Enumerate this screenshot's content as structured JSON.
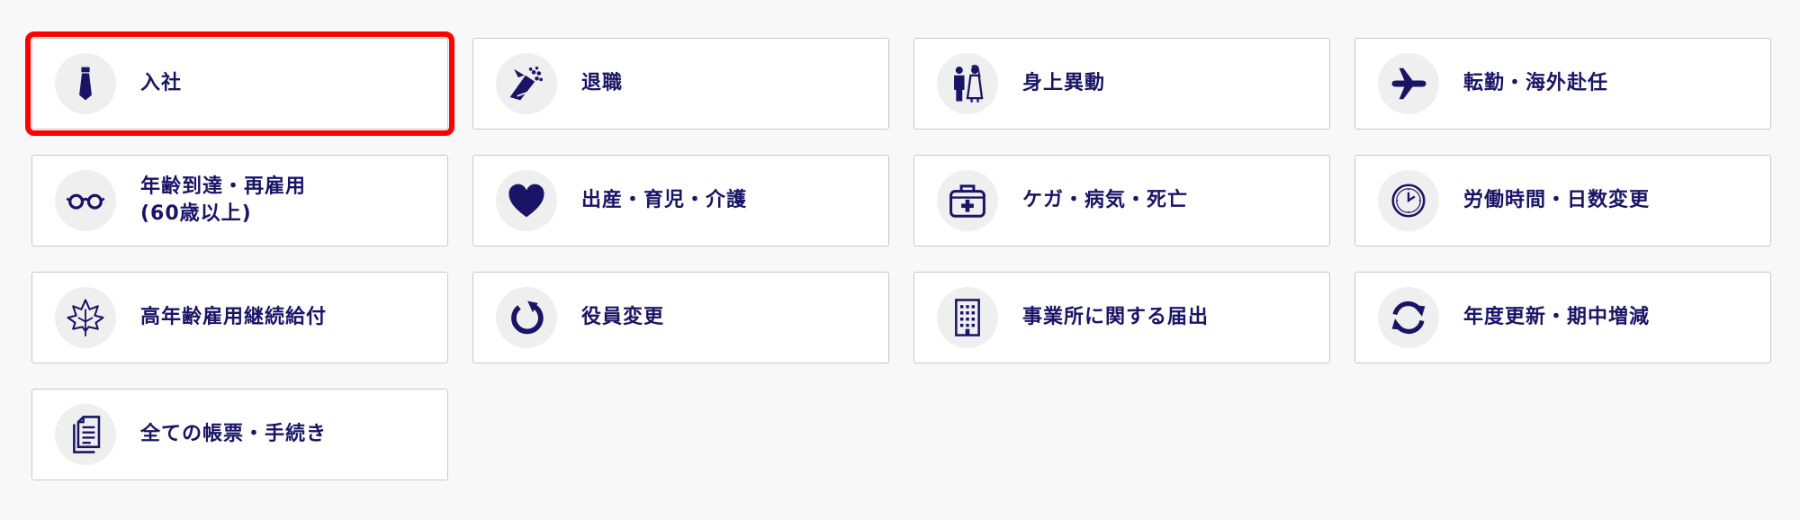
{
  "colors": {
    "icon": "#1a1466",
    "text": "#1a1466",
    "icon_bg": "#efefef",
    "selection": "#ff0000"
  },
  "procedures": [
    {
      "label": "入社",
      "icon": "necktie-icon",
      "selected": true
    },
    {
      "label": "退職",
      "icon": "bouquet-icon"
    },
    {
      "label": "身上異動",
      "icon": "wedding-couple-icon"
    },
    {
      "label": "転勤・海外赴任",
      "icon": "airplane-icon"
    },
    {
      "label": "年齢到達・再雇用",
      "label_line2": "(60歳以上)",
      "icon": "glasses-icon"
    },
    {
      "label": "出産・育児・介護",
      "icon": "heart-icon"
    },
    {
      "label": "ケガ・病気・死亡",
      "icon": "medical-kit-icon"
    },
    {
      "label": "労働時間・日数変更",
      "icon": "clock-icon"
    },
    {
      "label": "高年齢雇用継続給付",
      "icon": "maple-leaf-icon"
    },
    {
      "label": "役員変更",
      "icon": "rotate-arrow-icon"
    },
    {
      "label": "事業所に関する届出",
      "icon": "office-building-icon"
    },
    {
      "label": "年度更新・期中増減",
      "icon": "sync-arrows-icon"
    },
    {
      "label": "全ての帳票・手続き",
      "icon": "documents-icon"
    }
  ]
}
